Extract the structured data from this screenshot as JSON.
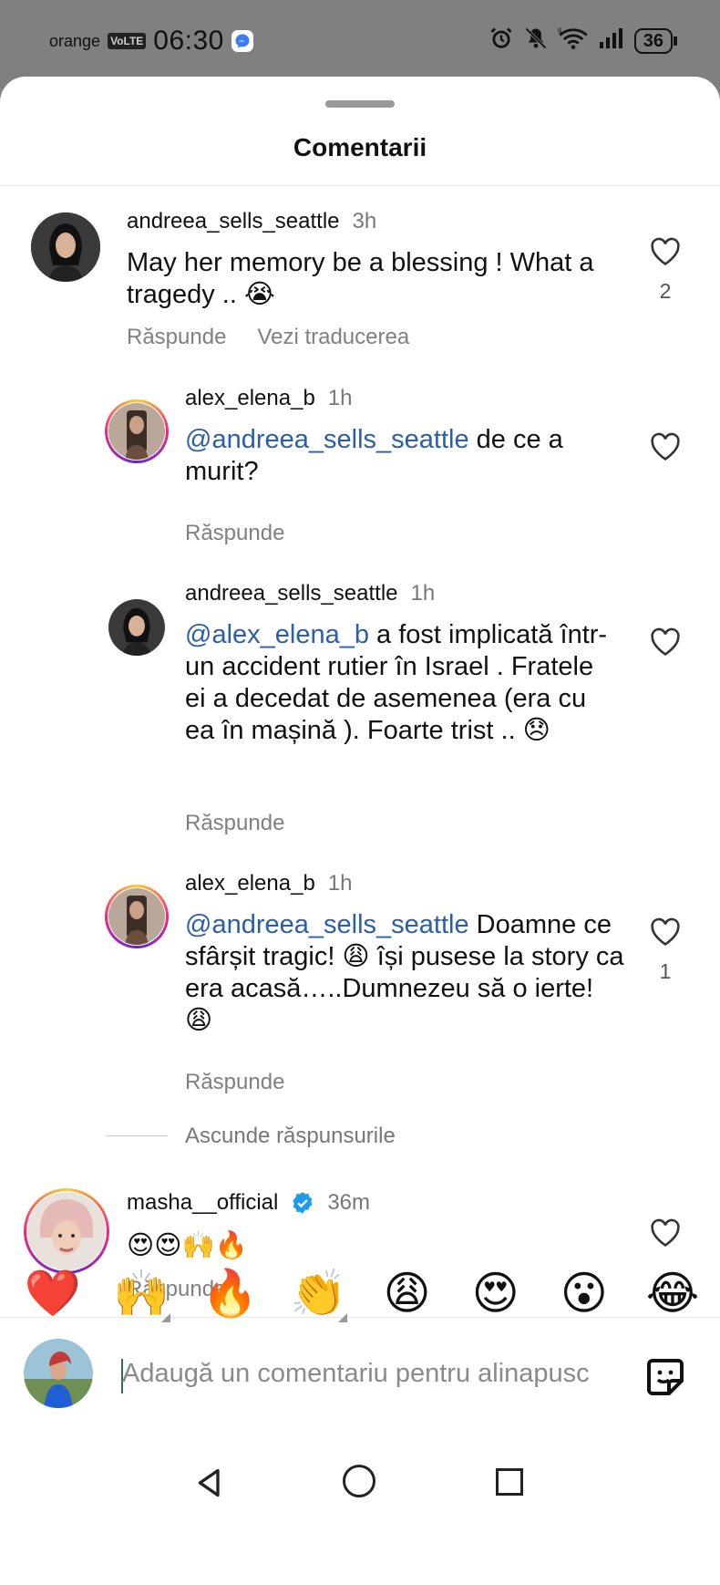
{
  "status_bar": {
    "carrier": "orange",
    "volte": "VoLTE",
    "time": "06:30",
    "battery": "36",
    "icons": [
      "messenger-icon",
      "alarm-icon",
      "mute-icon",
      "wifi-icon",
      "signal-icon",
      "battery-icon"
    ]
  },
  "sheet": {
    "title": "Comentarii"
  },
  "comments": [
    {
      "user": "andreea_sells_seattle",
      "time": "3h",
      "text": "May her memory be a blessing ! What a tragedy .. 😭",
      "likes": "2",
      "reply_label": "Răspunde",
      "translate_label": "Vezi traducerea"
    },
    {
      "user": "alex_elena_b",
      "time": "1h",
      "mention": "@andreea_sells_seattle",
      "text": " de ce a murit?",
      "reply_label": "Răspunde"
    },
    {
      "user": "andreea_sells_seattle",
      "time": "1h",
      "mention": "@alex_elena_b",
      "text": " a fost implicată într-un accident rutier în Israel . Fratele ei a decedat de asemenea (era cu ea în mașină ). Foarte trist .. 😞",
      "reply_label": "Răspunde"
    },
    {
      "user": "alex_elena_b",
      "time": "1h",
      "mention": "@andreea_sells_seattle",
      "text": " Doamne ce sfârșit tragic! 😩 își pusese la story ca era acasă…..Dumnezeu să o ierte! 😩",
      "likes": "1",
      "reply_label": "Răspunde"
    },
    {
      "user": "masha__official",
      "time": "36m",
      "text": "😍😍🙌🔥",
      "reply_label": "Răspunde"
    }
  ],
  "hide_replies": "Ascunde răspunsurile",
  "emoji_bar": [
    "❤️",
    "🙌",
    "🔥",
    "👏",
    "😩",
    "😍",
    "😮",
    "😂"
  ],
  "composer": {
    "placeholder": "Adaugă un comentariu pentru alinapusc"
  },
  "colors": {
    "mention": "#2b5ea7",
    "verified": "#1d9bf0",
    "sheet_bg": "#ffffff",
    "status_bg": "#808080"
  }
}
